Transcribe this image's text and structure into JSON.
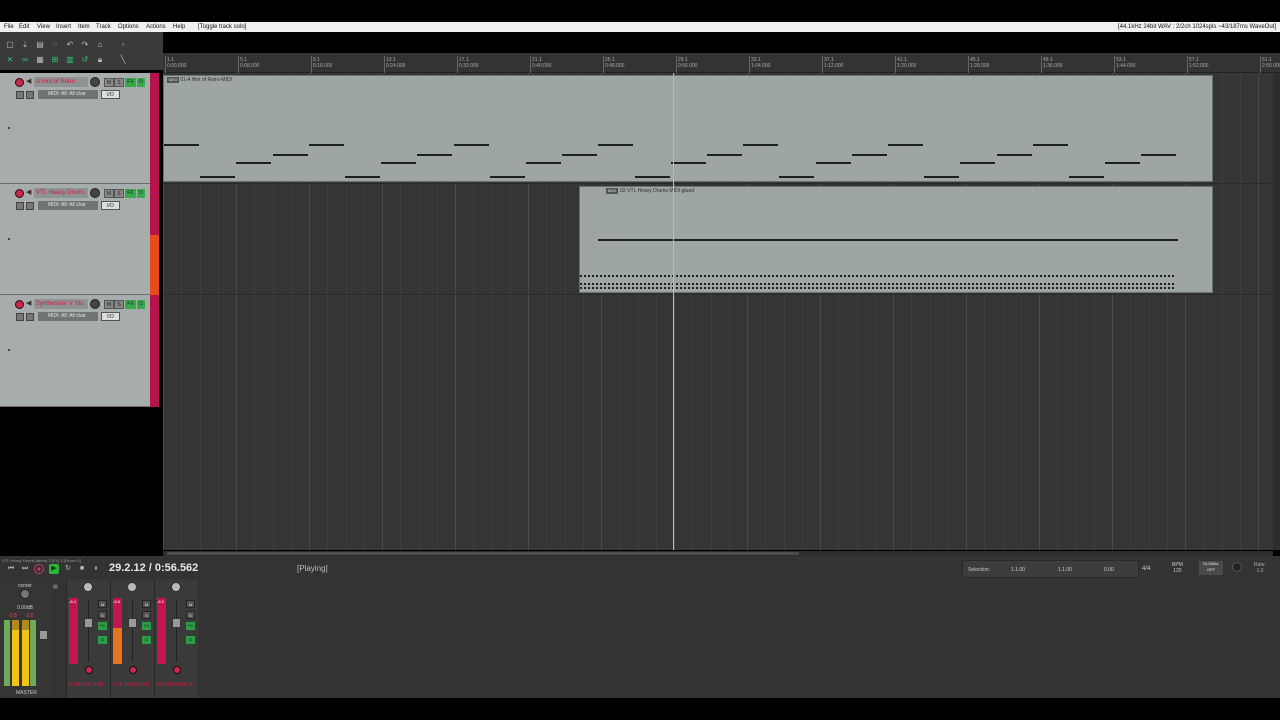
{
  "menubar": {
    "items": [
      "File",
      "Edit",
      "View",
      "Insert",
      "Item",
      "Track",
      "Options",
      "Actions",
      "Help"
    ],
    "action_hint": "[Toggle track solo]",
    "device_status": "[44.1kHz 24bit WAV : 2/2ch 1024spls ~43/187ms WaveOut]"
  },
  "ruler": {
    "marks": [
      {
        "bar": "1.1",
        "time": "0:00.000"
      },
      {
        "bar": "5.1",
        "time": "0:08.000"
      },
      {
        "bar": "9.1",
        "time": "0:16.000"
      },
      {
        "bar": "13.1",
        "time": "0:24.000"
      },
      {
        "bar": "17.1",
        "time": "0:32.000"
      },
      {
        "bar": "21.1",
        "time": "0:40.000"
      },
      {
        "bar": "25.1",
        "time": "0:48.000"
      },
      {
        "bar": "29.1",
        "time": "0:56.000"
      },
      {
        "bar": "33.1",
        "time": "1:04.000"
      },
      {
        "bar": "37.1",
        "time": "1:12.000"
      },
      {
        "bar": "41.1",
        "time": "1:20.000"
      },
      {
        "bar": "45.1",
        "time": "1:28.000"
      },
      {
        "bar": "49.1",
        "time": "1:36.000"
      },
      {
        "bar": "53.1",
        "time": "1:44.000"
      },
      {
        "bar": "57.1",
        "time": "1:52.000"
      },
      {
        "bar": "61.1",
        "time": "2:00.000"
      }
    ]
  },
  "tracks": [
    {
      "name": "A Hint of Retro",
      "midi_input": "MIDI: All: All char",
      "io": "I/O",
      "fx": "FX",
      "mute": "M",
      "solo": "S"
    },
    {
      "name": "VTL Heavy Drums",
      "midi_input": "MIDI: All: All char",
      "io": "I/O",
      "fx": "FX",
      "mute": "M",
      "solo": "S"
    },
    {
      "name": "Synthesizer V Stu",
      "midi_input": "MIDI: All: All char",
      "io": "I/O",
      "fx": "FX",
      "mute": "M",
      "solo": "S"
    }
  ],
  "items": [
    {
      "label": "01-A Hint of Retro-MIDI",
      "tag": "MIDI"
    },
    {
      "label": "02-VTL Heavy Drums-MIDI-glued",
      "tag": "MIDI"
    }
  ],
  "focus_label": "VTL Heavy Drums [items] 3 [FX] 1 [Serum 2]",
  "transport": {
    "position": "29.2.12 / 0:56.562",
    "state": "[Playing]"
  },
  "selection": {
    "label": "Selection:",
    "start": "1.1.00",
    "end": "1.1.00",
    "length": "0.00"
  },
  "time_signature": "4/4",
  "bpm_label": "BPM",
  "bpm_value": "120",
  "global_label": "GLOBAL",
  "global_state": "OFF",
  "rate_label": "Rate:",
  "rate_value": "1.0",
  "mixer": {
    "master_label": "MASTER",
    "master_pan": "center",
    "master_vol": "0.00dB",
    "master_peak_l": "-3.8",
    "master_peak_r": "-3.6",
    "master_meter_level": 0.85,
    "strips": [
      {
        "name": "A Hint of Retr",
        "vol": "-8.4",
        "level": 0.0
      },
      {
        "name": "VTL Heavy Dr",
        "vol": "-8.8",
        "level": 0.55
      },
      {
        "name": "Synthesizer V",
        "vol": "-8.3",
        "level": 0.0
      }
    ]
  },
  "colors": {
    "track_name": "#d9163f",
    "record_arm": "#c8284c",
    "fx_enabled": "#3aa84d",
    "play": "#28b63b",
    "play_cursor": "#c6c27a",
    "item": "#9ea6a5"
  }
}
